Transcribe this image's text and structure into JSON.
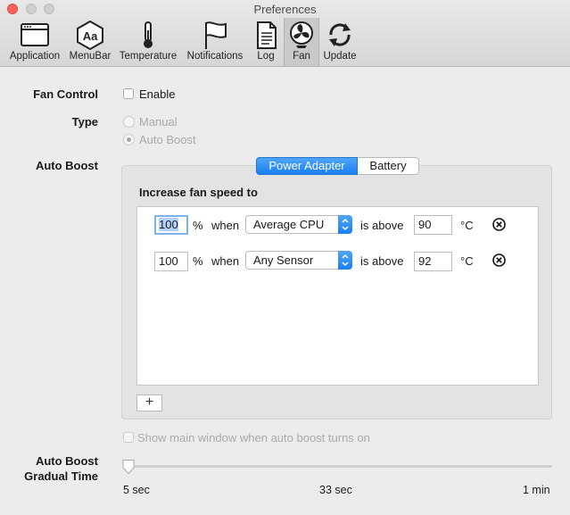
{
  "window": {
    "title": "Preferences"
  },
  "toolbar": {
    "items": [
      {
        "label": "Application",
        "icon": "application-window-icon"
      },
      {
        "label": "MenuBar",
        "icon": "menubar-hexagon-icon"
      },
      {
        "label": "Temperature",
        "icon": "thermometer-icon"
      },
      {
        "label": "Notifications",
        "icon": "flag-icon"
      },
      {
        "label": "Log",
        "icon": "document-log-icon"
      },
      {
        "label": "Fan",
        "icon": "fan-icon"
      },
      {
        "label": "Update",
        "icon": "refresh-arrows-icon"
      }
    ],
    "selected": "Fan",
    "menubar_icon_text": "Aa"
  },
  "fan_control": {
    "label": "Fan Control",
    "enable_label": "Enable",
    "enabled": false
  },
  "type": {
    "label": "Type",
    "options": [
      "Manual",
      "Auto Boost"
    ],
    "selected": "Auto Boost"
  },
  "auto_boost": {
    "label": "Auto Boost",
    "tabs": [
      "Power Adapter",
      "Battery"
    ],
    "selected_tab": "Power Adapter",
    "heading": "Increase fan speed to",
    "rules": [
      {
        "speed": "100",
        "percent": "%",
        "when": "when",
        "sensor": "Average CPU",
        "is_above": "is above",
        "threshold": "90",
        "unit": "°C"
      },
      {
        "speed": "100",
        "percent": "%",
        "when": "when",
        "sensor": "Any Sensor",
        "is_above": "is above",
        "threshold": "92",
        "unit": "°C"
      }
    ],
    "add_label": "+",
    "show_main_window_label": "Show main window when auto boost turns on",
    "show_main_window_checked": false
  },
  "gradual_time": {
    "label_line1": "Auto Boost",
    "label_line2": "Gradual Time",
    "ticks": [
      "5 sec",
      "33 sec",
      "1 min"
    ],
    "value_fraction": 0
  },
  "colors": {
    "accent": "#1a7ff2",
    "close": "#fc605b"
  }
}
